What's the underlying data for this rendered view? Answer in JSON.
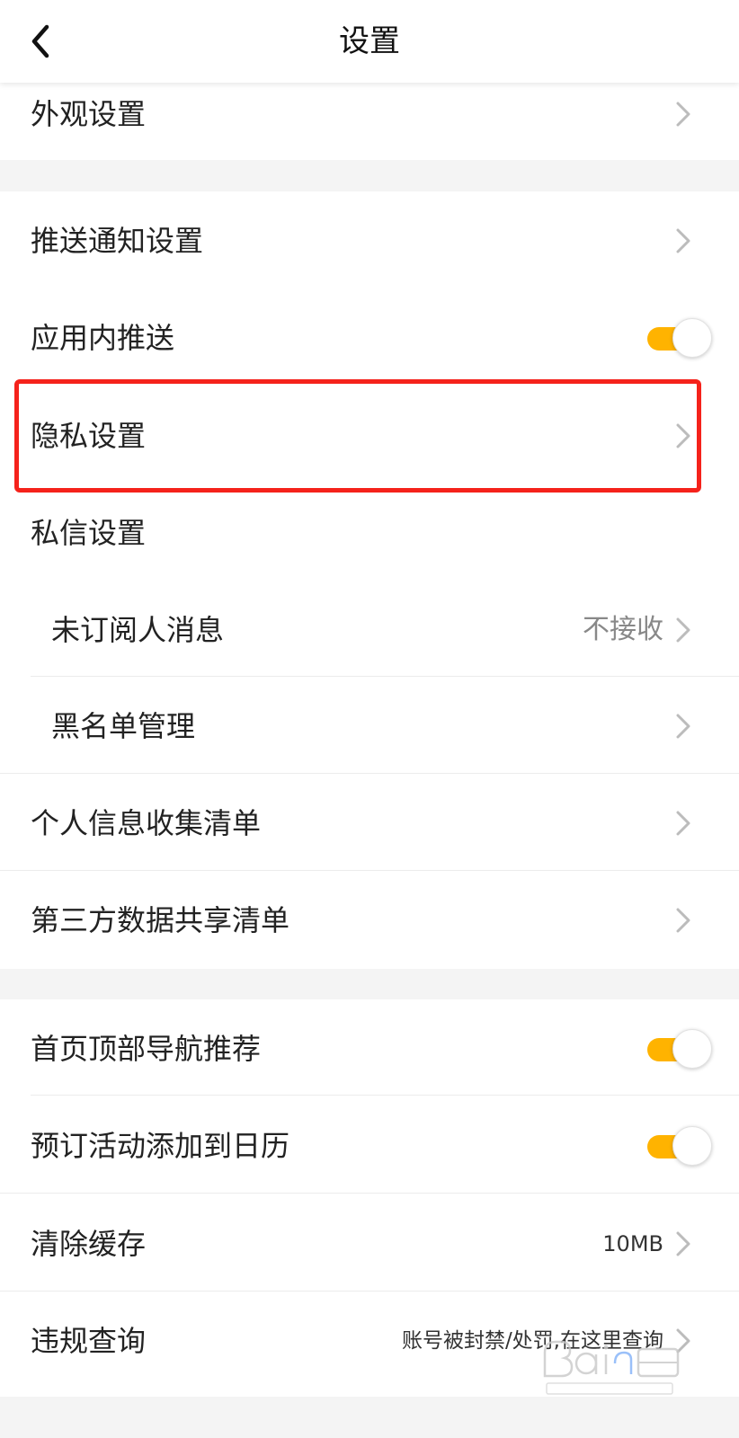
{
  "header": {
    "title": "设置"
  },
  "section1": {
    "items": [
      {
        "label": "外观设置"
      }
    ]
  },
  "section2": {
    "items": [
      {
        "label": "推送通知设置"
      },
      {
        "label": "应用内推送",
        "toggle_on": true
      },
      {
        "label": "隐私设置",
        "highlighted": true
      },
      {
        "label": "私信设置"
      },
      {
        "label": "未订阅人消息",
        "value": "不接收"
      },
      {
        "label": "黑名单管理"
      },
      {
        "label": "个人信息收集清单"
      },
      {
        "label": "第三方数据共享清单"
      }
    ]
  },
  "section3": {
    "items": [
      {
        "label": "首页顶部导航推荐",
        "toggle_on": true
      },
      {
        "label": "预订活动添加到日历",
        "toggle_on": true
      },
      {
        "label": "清除缓存",
        "value": "10MB"
      },
      {
        "label": "违规查询",
        "value": "账号被封禁/处罚,在这里查询"
      }
    ]
  },
  "colors": {
    "toggle_on": "#ffb300",
    "highlight_border": "#f5221b",
    "background": "#f4f4f4"
  },
  "icons": {
    "back": "chevron-left-icon",
    "chevron": "chevron-right-icon"
  }
}
